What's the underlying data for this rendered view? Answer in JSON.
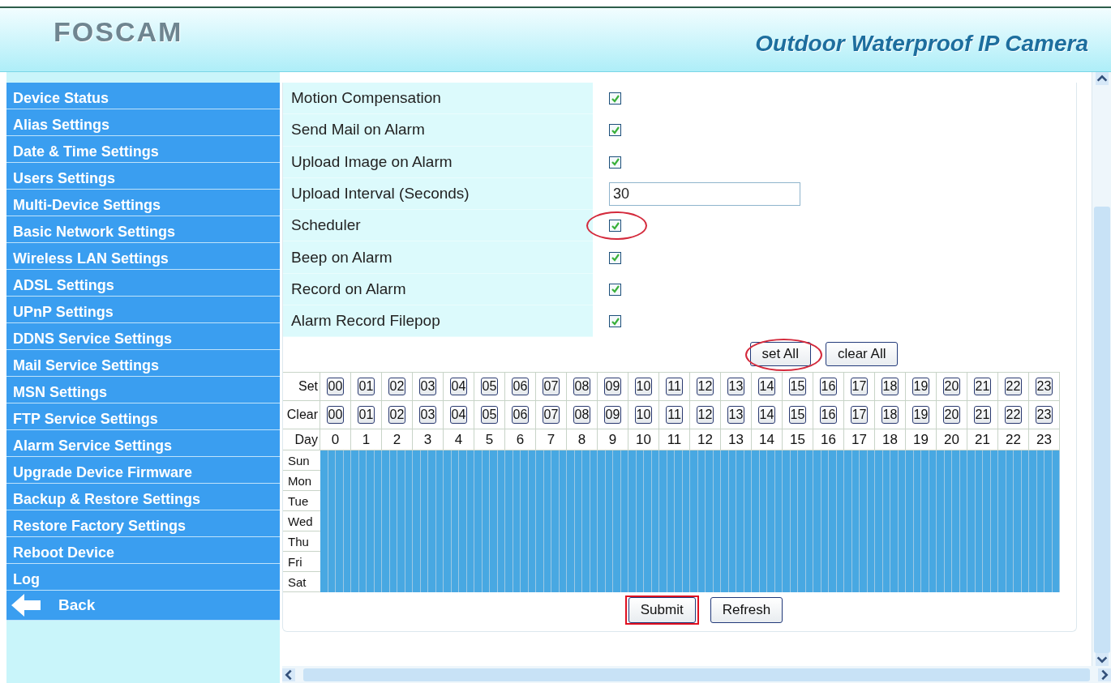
{
  "header": {
    "logo": "FOSCAM",
    "product": "Outdoor Waterproof IP Camera"
  },
  "sidebar": {
    "items": [
      {
        "label": "Device Status"
      },
      {
        "label": "Alias Settings"
      },
      {
        "label": "Date & Time Settings"
      },
      {
        "label": "Users Settings"
      },
      {
        "label": "Multi-Device Settings"
      },
      {
        "label": "Basic Network Settings"
      },
      {
        "label": "Wireless LAN Settings"
      },
      {
        "label": "ADSL Settings"
      },
      {
        "label": "UPnP Settings"
      },
      {
        "label": "DDNS Service Settings"
      },
      {
        "label": "Mail Service Settings"
      },
      {
        "label": "MSN Settings"
      },
      {
        "label": "FTP Service Settings"
      },
      {
        "label": "Alarm Service Settings"
      },
      {
        "label": "Upgrade Device Firmware"
      },
      {
        "label": "Backup & Restore Settings"
      },
      {
        "label": "Restore Factory Settings"
      },
      {
        "label": "Reboot Device"
      },
      {
        "label": "Log"
      }
    ],
    "back": "Back"
  },
  "settings": [
    {
      "label": "Motion Compensation",
      "kind": "checkbox",
      "checked": true,
      "circled": false
    },
    {
      "label": "Send Mail on Alarm",
      "kind": "checkbox",
      "checked": true,
      "circled": false
    },
    {
      "label": "Upload Image on Alarm",
      "kind": "checkbox",
      "checked": true,
      "circled": false
    },
    {
      "label": "Upload Interval (Seconds)",
      "kind": "text",
      "value": "30",
      "circled": false
    },
    {
      "label": "Scheduler",
      "kind": "checkbox",
      "checked": true,
      "circled": true
    },
    {
      "label": "Beep on Alarm",
      "kind": "checkbox",
      "checked": true,
      "circled": false
    },
    {
      "label": "Record on Alarm",
      "kind": "checkbox",
      "checked": true,
      "circled": false
    },
    {
      "label": "Alarm Record Filepop",
      "kind": "checkbox",
      "checked": true,
      "circled": false
    }
  ],
  "schedule_buttons": [
    {
      "label": "set All",
      "circled": true
    },
    {
      "label": "clear All",
      "circled": false
    }
  ],
  "schedule": {
    "set_label": "Set",
    "set_hours": [
      "00",
      "01",
      "02",
      "03",
      "04",
      "05",
      "06",
      "07",
      "08",
      "09",
      "10",
      "11",
      "12",
      "13",
      "14",
      "15",
      "16",
      "17",
      "18",
      "19",
      "20",
      "21",
      "22",
      "23"
    ],
    "clear_label": "Clear",
    "clear_hours": [
      "00",
      "01",
      "02",
      "03",
      "04",
      "05",
      "06",
      "07",
      "08",
      "09",
      "10",
      "11",
      "12",
      "13",
      "14",
      "15",
      "16",
      "17",
      "18",
      "19",
      "20",
      "21",
      "22",
      "23"
    ],
    "day_label": "Day",
    "hours": [
      "0",
      "1",
      "2",
      "3",
      "4",
      "5",
      "6",
      "7",
      "8",
      "9",
      "10",
      "11",
      "12",
      "13",
      "14",
      "15",
      "16",
      "17",
      "18",
      "19",
      "20",
      "21",
      "22",
      "23"
    ],
    "days": [
      {
        "label": "Sun",
        "set": true
      },
      {
        "label": "Mon",
        "set": true
      },
      {
        "label": "Tue",
        "set": true
      },
      {
        "label": "Wed",
        "set": true
      },
      {
        "label": "Thu",
        "set": true
      },
      {
        "label": "Fri",
        "set": true
      },
      {
        "label": "Sat",
        "set": true
      }
    ]
  },
  "actions": [
    {
      "label": "Submit",
      "boxed": true
    },
    {
      "label": "Refresh",
      "boxed": false
    }
  ]
}
